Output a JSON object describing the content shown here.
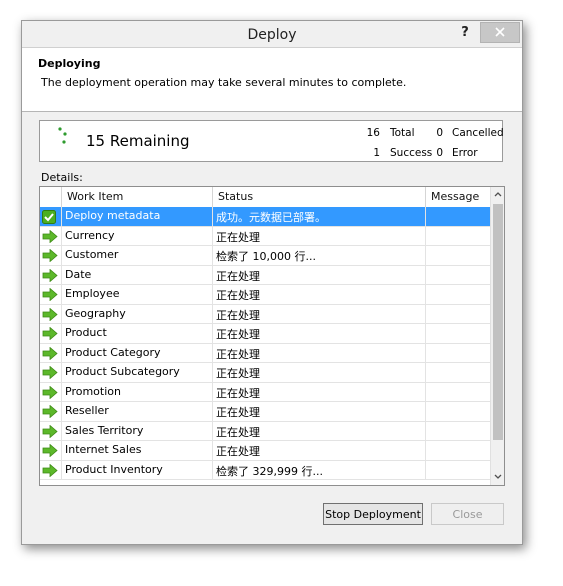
{
  "window": {
    "title": "Deploy",
    "help_label": "?"
  },
  "header": {
    "title": "Deploying",
    "description": "The deployment operation may take several minutes to complete."
  },
  "summary": {
    "remaining_text": "15 Remaining",
    "total_count": "16",
    "total_label": "Total",
    "cancelled_count": "0",
    "cancelled_label": "Cancelled",
    "success_count": "1",
    "success_label": "Success",
    "error_count": "0",
    "error_label": "Error"
  },
  "details": {
    "label": "Details:",
    "columns": [
      "Work Item",
      "Status",
      "Message"
    ],
    "rows": [
      {
        "icon": "check-icon",
        "item": "Deploy metadata",
        "status": "成功。元数据已部署。",
        "message": ""
      },
      {
        "icon": "arrow-right-icon",
        "item": "Currency",
        "status": "正在处理",
        "message": ""
      },
      {
        "icon": "arrow-right-icon",
        "item": "Customer",
        "status": "检索了 10,000 行...",
        "message": ""
      },
      {
        "icon": "arrow-right-icon",
        "item": "Date",
        "status": "正在处理",
        "message": ""
      },
      {
        "icon": "arrow-right-icon",
        "item": "Employee",
        "status": "正在处理",
        "message": ""
      },
      {
        "icon": "arrow-right-icon",
        "item": "Geography",
        "status": "正在处理",
        "message": ""
      },
      {
        "icon": "arrow-right-icon",
        "item": "Product",
        "status": "正在处理",
        "message": ""
      },
      {
        "icon": "arrow-right-icon",
        "item": "Product Category",
        "status": "正在处理",
        "message": ""
      },
      {
        "icon": "arrow-right-icon",
        "item": "Product Subcategory",
        "status": "正在处理",
        "message": ""
      },
      {
        "icon": "arrow-right-icon",
        "item": "Promotion",
        "status": "正在处理",
        "message": ""
      },
      {
        "icon": "arrow-right-icon",
        "item": "Reseller",
        "status": "正在处理",
        "message": ""
      },
      {
        "icon": "arrow-right-icon",
        "item": "Sales Territory",
        "status": "正在处理",
        "message": ""
      },
      {
        "icon": "arrow-right-icon",
        "item": "Internet Sales",
        "status": "正在处理",
        "message": ""
      },
      {
        "icon": "arrow-right-icon",
        "item": "Product Inventory",
        "status": "检索了 329,999 行...",
        "message": ""
      }
    ]
  },
  "buttons": {
    "stop_label": "Stop Deployment",
    "close_label": "Close"
  },
  "colors": {
    "selection": "#3399ff",
    "success_green": "#4caf22",
    "arrow_green": "#5cb82a"
  }
}
